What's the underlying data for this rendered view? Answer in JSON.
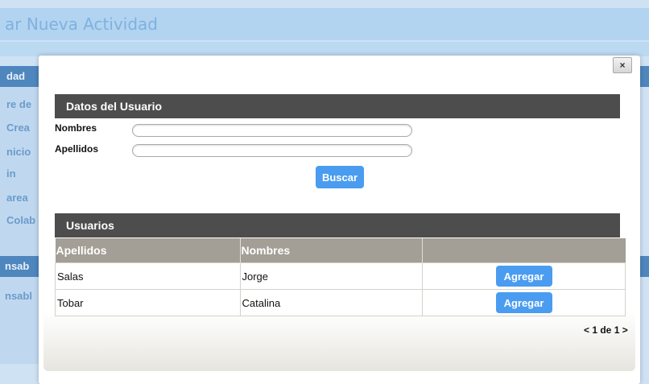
{
  "background": {
    "title": "ar Nueva Actividad",
    "sidebar_head": "dad",
    "sidebar_items": [
      "re de",
      "Crea",
      "nicio",
      "in",
      "area",
      "Colab"
    ],
    "sidebar_head2": "nsab",
    "sidebar_items2": [
      "nsabl"
    ]
  },
  "modal": {
    "close_label": "×",
    "datos_section": "Datos del Usuario",
    "nombres_label": "Nombres",
    "nombres_value": "",
    "apellidos_label": "Apellidos",
    "apellidos_value": "",
    "search_label": "Buscar",
    "usuarios_section": "Usuarios",
    "table": {
      "headers": [
        "Apellidos",
        "Nombres",
        ""
      ],
      "rows": [
        {
          "apellidos": "Salas",
          "nombres": "Jorge",
          "action": "Agregar"
        },
        {
          "apellidos": "Tobar",
          "nombres": "Catalina",
          "action": "Agregar"
        }
      ]
    },
    "pager": "< 1 de 1 >"
  }
}
